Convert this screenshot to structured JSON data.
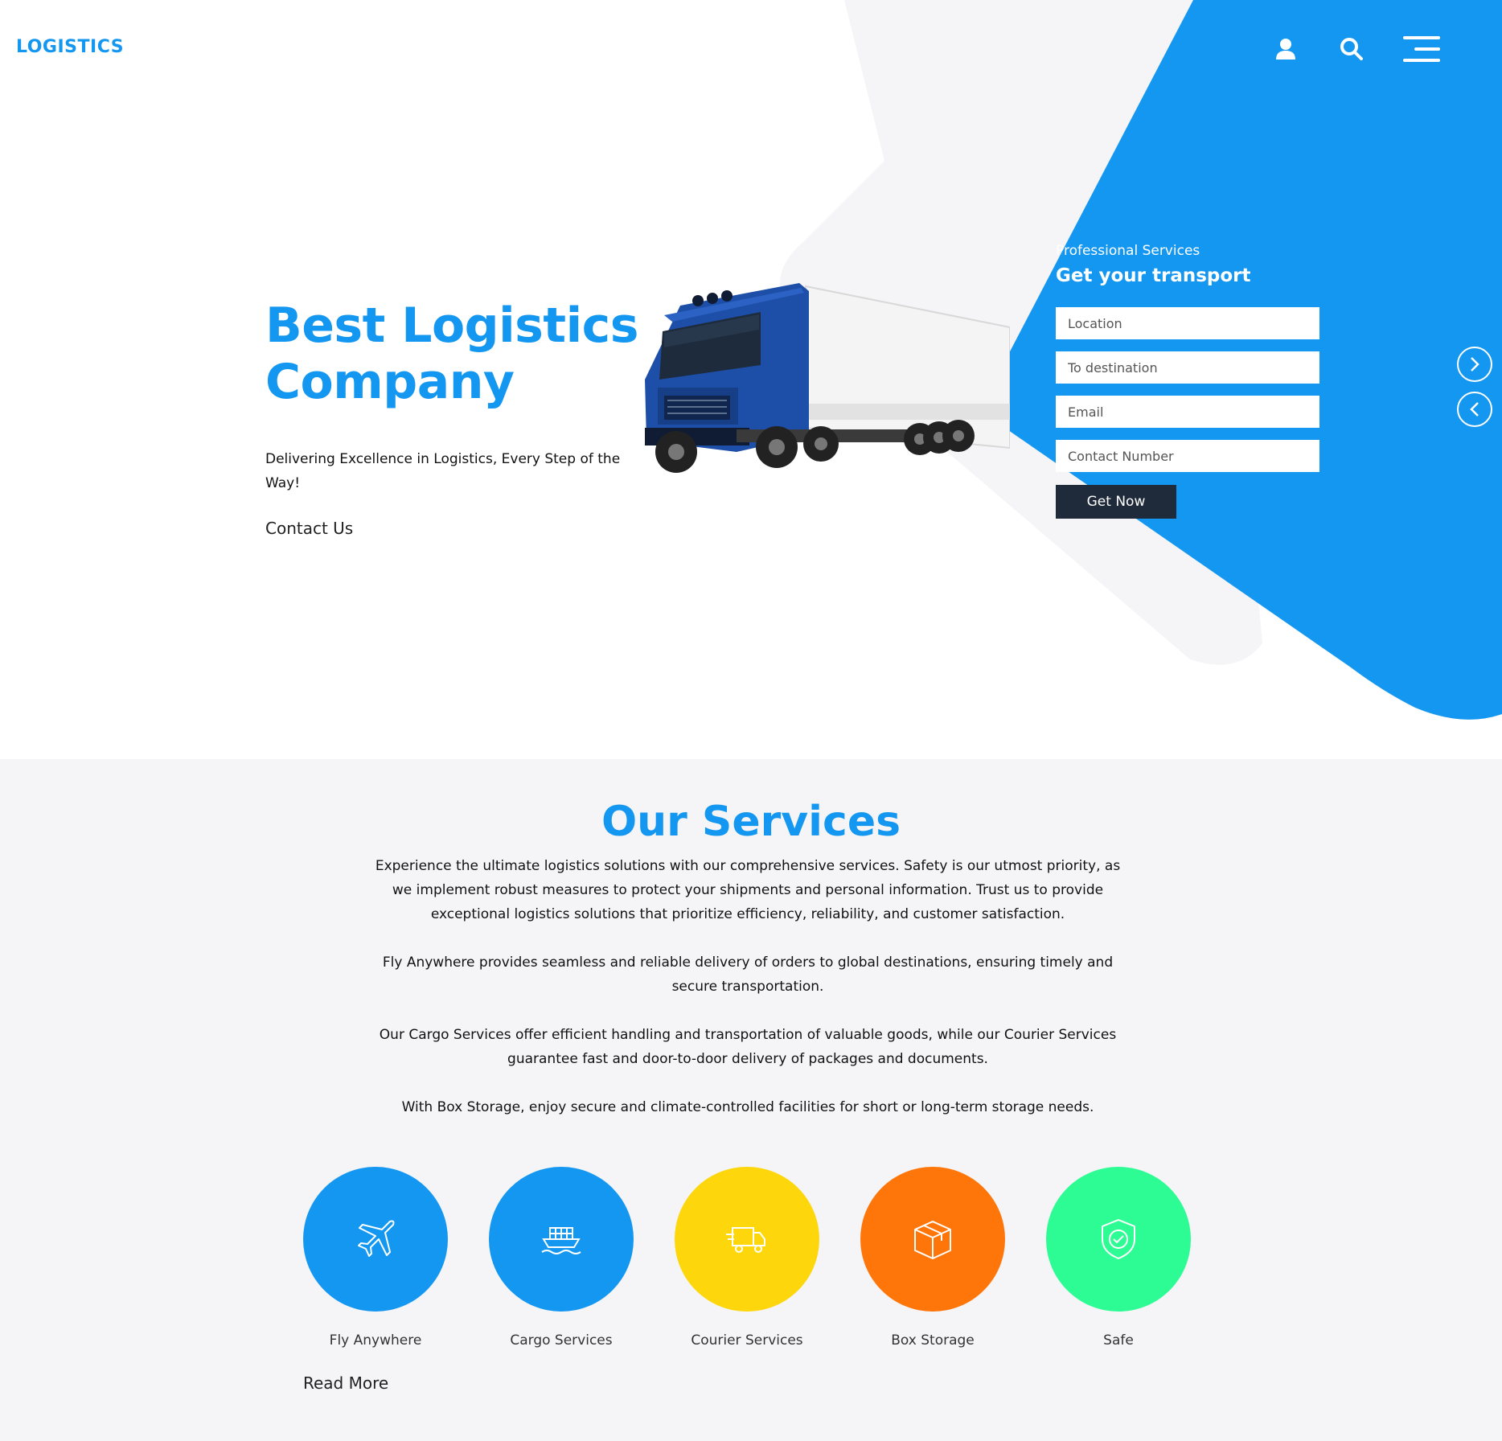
{
  "brand": {
    "logo": "LOGISTICS"
  },
  "colors": {
    "primary": "#1497f0",
    "dark_button": "#1f2a3a",
    "light_shape": "#f5f5f7",
    "section_bg": "#f5f5f7"
  },
  "nav": {
    "icons": [
      "user-icon",
      "search-icon",
      "menu-icon"
    ]
  },
  "hero": {
    "title": "Best Logistics Company",
    "subtitle": "Delivering Excellence in Logistics, Every Step of the Way!",
    "contact_link": "Contact Us",
    "carousel_controls": [
      "chevron-right-icon",
      "chevron-left-icon"
    ]
  },
  "booking_form": {
    "kicker": "Professional Services",
    "title": "Get your transport",
    "fields": {
      "location": {
        "placeholder": "Location",
        "value": ""
      },
      "destination": {
        "placeholder": "To destination",
        "value": ""
      },
      "email": {
        "placeholder": "Email",
        "value": ""
      },
      "contact_number": {
        "placeholder": "Contact Number",
        "value": ""
      }
    },
    "submit_label": "Get Now"
  },
  "services": {
    "title": "Our Services",
    "paragraphs": [
      "Experience the ultimate logistics solutions with our comprehensive services. Safety is our utmost priority, as we implement robust measures to protect your shipments and personal information. Trust us to provide exceptional logistics solutions that prioritize efficiency, reliability, and customer satisfaction.",
      "Fly Anywhere provides seamless and reliable delivery of orders to global destinations, ensuring timely and secure transportation.",
      "Our Cargo Services offer efficient handling and transportation of valuable goods, while our Courier Services guarantee fast and door-to-door delivery of packages and documents.",
      "With Box Storage, enjoy secure and climate-controlled facilities for short or long-term storage needs."
    ],
    "items": [
      {
        "label": "Fly Anywhere",
        "icon": "airplane-icon",
        "color": "#1497f0"
      },
      {
        "label": "Cargo Services",
        "icon": "cargo-ship-icon",
        "color": "#1497f0"
      },
      {
        "label": "Courier Services",
        "icon": "delivery-truck-icon",
        "color": "#fdd60c"
      },
      {
        "label": "Box Storage",
        "icon": "box-icon",
        "color": "#fe760a"
      },
      {
        "label": "Safe",
        "icon": "shield-check-icon",
        "color": "#2dfc94"
      }
    ],
    "read_more": "Read More"
  }
}
